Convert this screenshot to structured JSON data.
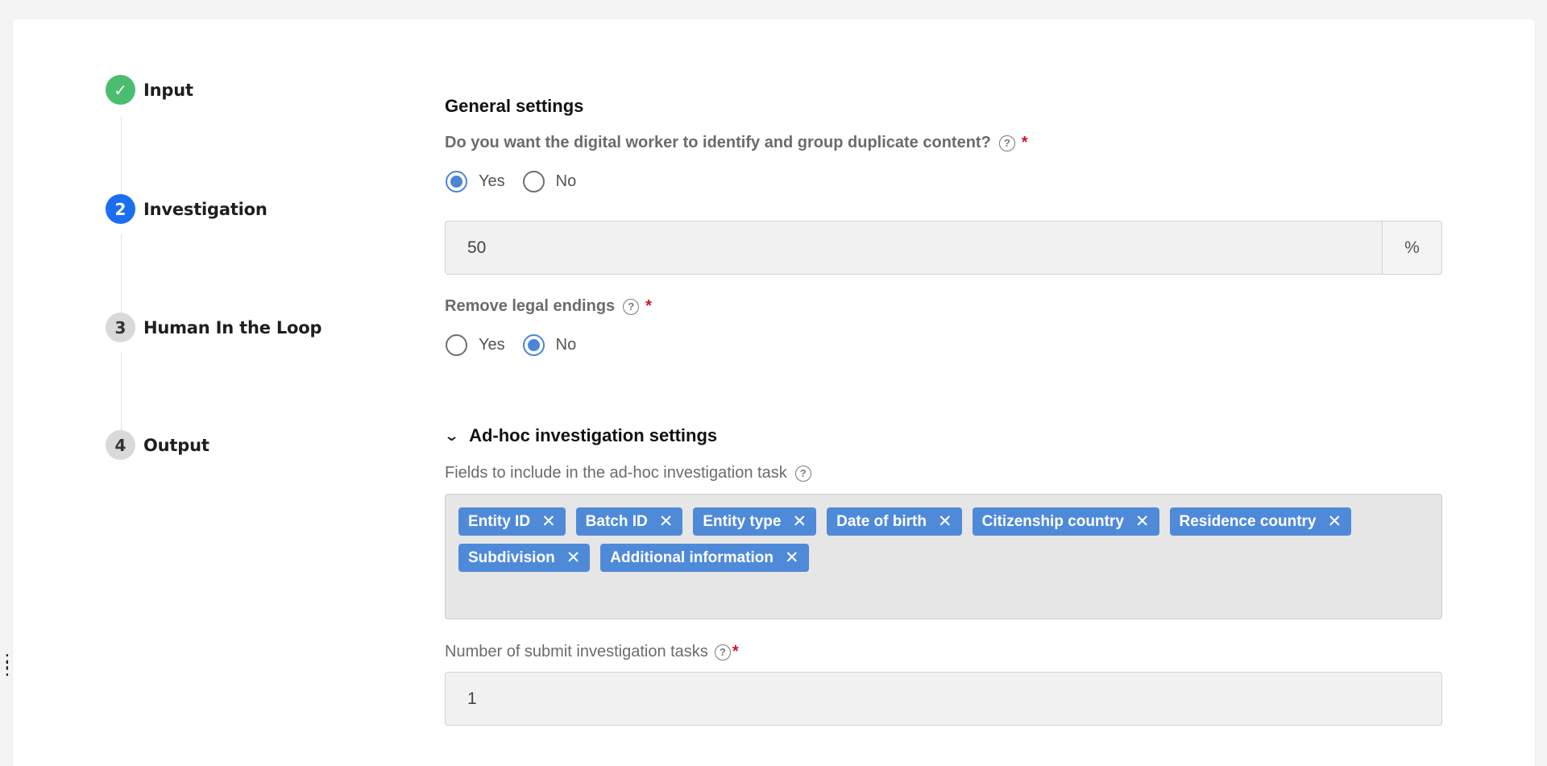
{
  "stepper": {
    "steps": [
      {
        "number": "✓",
        "label": "Input",
        "state": "done"
      },
      {
        "number": "2",
        "label": "Investigation",
        "state": "active"
      },
      {
        "number": "3",
        "label": "Human In the Loop",
        "state": "todo"
      },
      {
        "number": "4",
        "label": "Output",
        "state": "todo"
      }
    ]
  },
  "general": {
    "title": "General settings",
    "duplicate_question": "Do you want the digital worker to identify and group duplicate content?",
    "duplicate_options": {
      "yes": "Yes",
      "no": "No"
    },
    "duplicate_selected": "Yes",
    "threshold_value": "50",
    "threshold_suffix": "%",
    "legal_endings_label": "Remove legal endings",
    "legal_options": {
      "yes": "Yes",
      "no": "No"
    },
    "legal_selected": "No",
    "required_mark": "*",
    "help_glyph": "?"
  },
  "adhoc": {
    "title": "Ad-hoc investigation settings",
    "fields_label": "Fields to include in the ad-hoc investigation task",
    "tags_row1": [
      "Entity ID",
      "Batch ID",
      "Entity type",
      "Date of birth",
      "Citizenship country",
      "Residence country"
    ],
    "tags_row2": [
      "Subdivision",
      "Additional information"
    ],
    "tag_remove_glyph": "✕",
    "submit_tasks_label": "Number of submit investigation tasks",
    "submit_tasks_value": "1"
  },
  "colors": {
    "done": "#4bbd6e",
    "active": "#1b6ef0",
    "tag": "#4f8ad9",
    "required": "#d0112b"
  }
}
